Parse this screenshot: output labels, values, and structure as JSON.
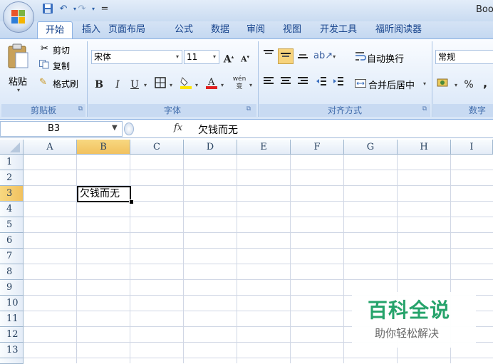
{
  "window": {
    "title": "Boo"
  },
  "quick_access": {
    "save_icon": "save-icon",
    "undo_icon": "undo-icon",
    "redo_icon": "redo-icon",
    "customize_glyph": "="
  },
  "tabs": [
    {
      "label": "开始",
      "active": true
    },
    {
      "label": "插入"
    },
    {
      "label": "页面布局"
    },
    {
      "label": "公式"
    },
    {
      "label": "数据"
    },
    {
      "label": "审阅"
    },
    {
      "label": "视图"
    },
    {
      "label": "开发工具"
    },
    {
      "label": "福昕阅读器"
    }
  ],
  "ribbon": {
    "clipboard": {
      "label": "剪贴板",
      "paste": "粘贴",
      "cut": "剪切",
      "copy": "复制",
      "format_painter": "格式刷"
    },
    "font": {
      "label": "字体",
      "font_name": "宋体",
      "font_size": "11",
      "bold": "B",
      "italic": "I",
      "underline": "U",
      "grow": "A",
      "shrink": "A",
      "wen": "wén 变"
    },
    "alignment": {
      "label": "对齐方式",
      "wrap_text": "自动换行",
      "merge_center": "合并后居中"
    },
    "number": {
      "label": "数字",
      "format": "常规",
      "percent": "%",
      "comma": ","
    }
  },
  "formula_bar": {
    "name_box": "B3",
    "fx": "fx",
    "content": "欠钱而无"
  },
  "sheet": {
    "columns": [
      "A",
      "B",
      "C",
      "D",
      "E",
      "F",
      "G",
      "H",
      "I"
    ],
    "rows": [
      "1",
      "2",
      "3",
      "4",
      "5",
      "6",
      "7",
      "8",
      "9",
      "10",
      "11",
      "12",
      "13"
    ],
    "selected_column": "B",
    "selected_row": "3",
    "active_cell_value": "欠钱而无"
  },
  "watermark": {
    "title": "百科全说",
    "subtitle": "助你轻松解决"
  },
  "colors": {
    "accent": "#15428b",
    "selection_header": "#f8d880",
    "watermark_green": "#26a36b"
  }
}
